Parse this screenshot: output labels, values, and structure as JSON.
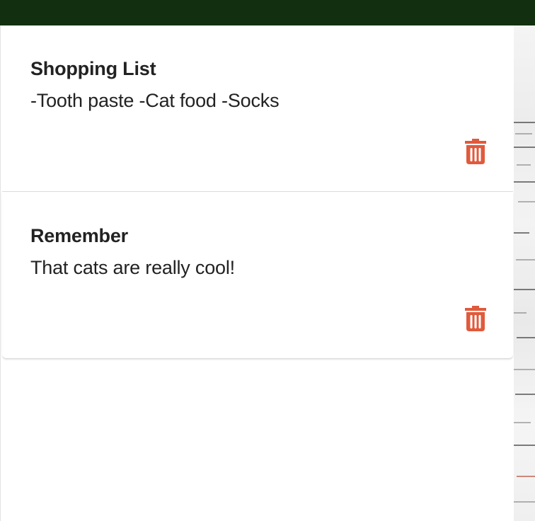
{
  "theme": {
    "header_color": "#12300f",
    "delete_icon_color": "#e05a3c",
    "text_color": "#222222"
  },
  "notes": [
    {
      "title": "Shopping List",
      "content": "-Tooth paste -Cat food -Socks",
      "delete_icon": "trash-icon"
    },
    {
      "title": "Remember",
      "content": "That cats are really cool!",
      "delete_icon": "trash-icon"
    }
  ]
}
